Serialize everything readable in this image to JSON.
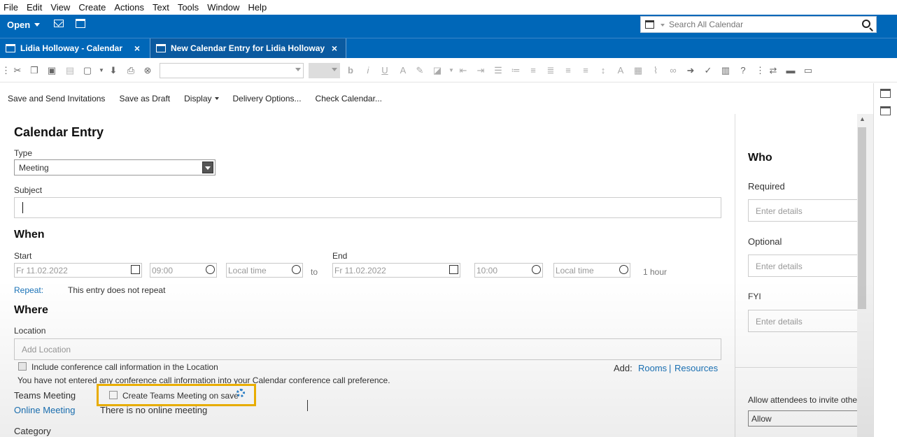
{
  "menu": [
    "File",
    "Edit",
    "View",
    "Create",
    "Actions",
    "Text",
    "Tools",
    "Window",
    "Help"
  ],
  "toolbar": {
    "open_label": "Open",
    "search_placeholder": "Search All Calendar"
  },
  "tabs": [
    {
      "label": "Lidia Holloway - Calendar",
      "close": "×"
    },
    {
      "label": "New Calendar Entry for Lidia Holloway",
      "close": "×"
    }
  ],
  "actions": {
    "save_send": "Save and Send Invitations",
    "save_draft": "Save as Draft",
    "display": "Display",
    "delivery": "Delivery Options...",
    "check_calendar": "Check Calendar..."
  },
  "form": {
    "title": "Calendar Entry",
    "type_label": "Type",
    "type_value": "Meeting",
    "subject_label": "Subject",
    "when_heading": "When",
    "start_label": "Start",
    "start_date": "Fr 11.02.2022",
    "start_time": "09:00",
    "start_tz": "Local time",
    "to_label": "to",
    "end_label": "End",
    "end_date": "Fr 11.02.2022",
    "end_time": "10:00",
    "end_tz": "Local time",
    "duration": "1 hour",
    "repeat_label": "Repeat:",
    "repeat_value": "This entry does not repeat",
    "where_heading": "Where",
    "location_label": "Location",
    "location_placeholder": "Add Location",
    "conf_checkbox_label": "Include conference call information in the Location",
    "add_label": "Add:",
    "rooms_link": "Rooms",
    "separator": "|",
    "resources_link": "Resources",
    "conf_message": "You have not entered any conference call information into your Calendar conference call preference.",
    "teams_label": "Teams Meeting",
    "teams_checkbox_label": "Create Teams Meeting on save",
    "online_label": "Online Meeting",
    "online_value": "There is no online meeting",
    "category_label": "Category"
  },
  "who": {
    "heading": "Who",
    "required_label": "Required",
    "required_placeholder": "Enter details",
    "optional_label": "Optional",
    "optional_placeholder": "Enter details",
    "fyi_label": "FYI",
    "fyi_placeholder": "Enter details",
    "invite_label": "Allow attendees to invite othe",
    "invite_value": "Allow"
  },
  "colors": {
    "brand_blue": "#0067b8",
    "highlight": "#f5b600",
    "link": "#1a73b8"
  }
}
